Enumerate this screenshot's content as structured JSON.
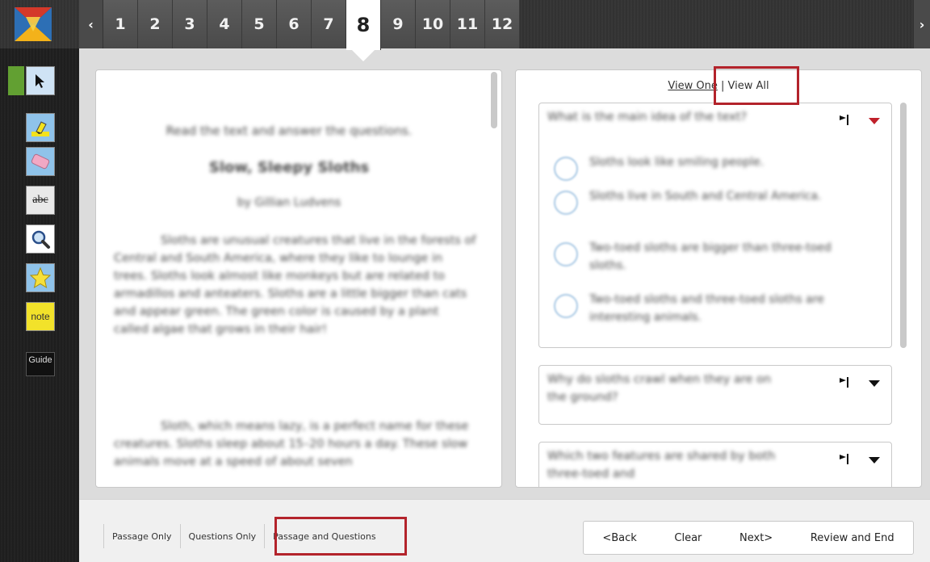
{
  "question_nav": {
    "prev_icon": "chevron-left-icon",
    "next_icon": "chevron-right-icon",
    "items": [
      "1",
      "2",
      "3",
      "4",
      "5",
      "6",
      "7",
      "8",
      "9",
      "10",
      "11",
      "12"
    ],
    "active": "8"
  },
  "tools": {
    "items": [
      {
        "name": "pointer-tool",
        "icon": "arrow-pointer-icon"
      },
      {
        "name": "highlighter-tool",
        "icon": "highlighter-icon"
      },
      {
        "name": "eraser-tool",
        "icon": "eraser-icon"
      },
      {
        "name": "strikethrough-tool",
        "label": "abc"
      },
      {
        "name": "magnifier-tool",
        "icon": "magnifier-icon"
      },
      {
        "name": "star-tool",
        "icon": "star-icon"
      },
      {
        "name": "note-tool",
        "label": "note"
      },
      {
        "name": "guide-tool",
        "label": "Guide"
      }
    ],
    "strike_label": "abc",
    "note_label": "note",
    "guide_label": "Guide"
  },
  "passage": {
    "instructions": "Read the text and answer the questions.",
    "title": "Slow, Sleepy Sloths",
    "author": "by Gillian Ludvens",
    "paragraphs": [
      "Sloths are unusual creatures that live in the forests of Central and South America, where they like to lounge in trees. Sloths look almost like monkeys but are related to armadillos and anteaters. Sloths are a little bigger than cats and appear green. The green color is caused by a plant called algae that grows in their hair!",
      "Sloth, which means lazy, is a perfect name for these creatures. Sloths sleep about 15–20 hours a day. These slow animals move at a speed of about seven"
    ]
  },
  "view_toggle": {
    "view_one": "View One",
    "separator": "|",
    "view_all": "View All"
  },
  "questions": [
    {
      "stem": "What is the main idea of the text?",
      "options": [
        "Sloths look like smiling people.",
        "Sloths live in South and Central America.",
        "Two-toed sloths are bigger than three-toed sloths.",
        "Two-toed sloths and three-toed sloths are interesting animals."
      ]
    },
    {
      "stem": "Why do sloths crawl when they are on the ground?"
    },
    {
      "stem": "Which two features are shared by both three-toed and"
    }
  ],
  "modes": {
    "passage_only": "Passage Only",
    "questions_only": "Questions Only",
    "passage_and_questions": "Passage and Questions"
  },
  "nav_buttons": {
    "back": "<Back",
    "clear": "Clear",
    "next": "Next>",
    "review": "Review and End"
  },
  "colors": {
    "highlight_outline": "#b3232b",
    "toolbar_accent": "#62a032",
    "open_arrow": "#c0202a"
  }
}
